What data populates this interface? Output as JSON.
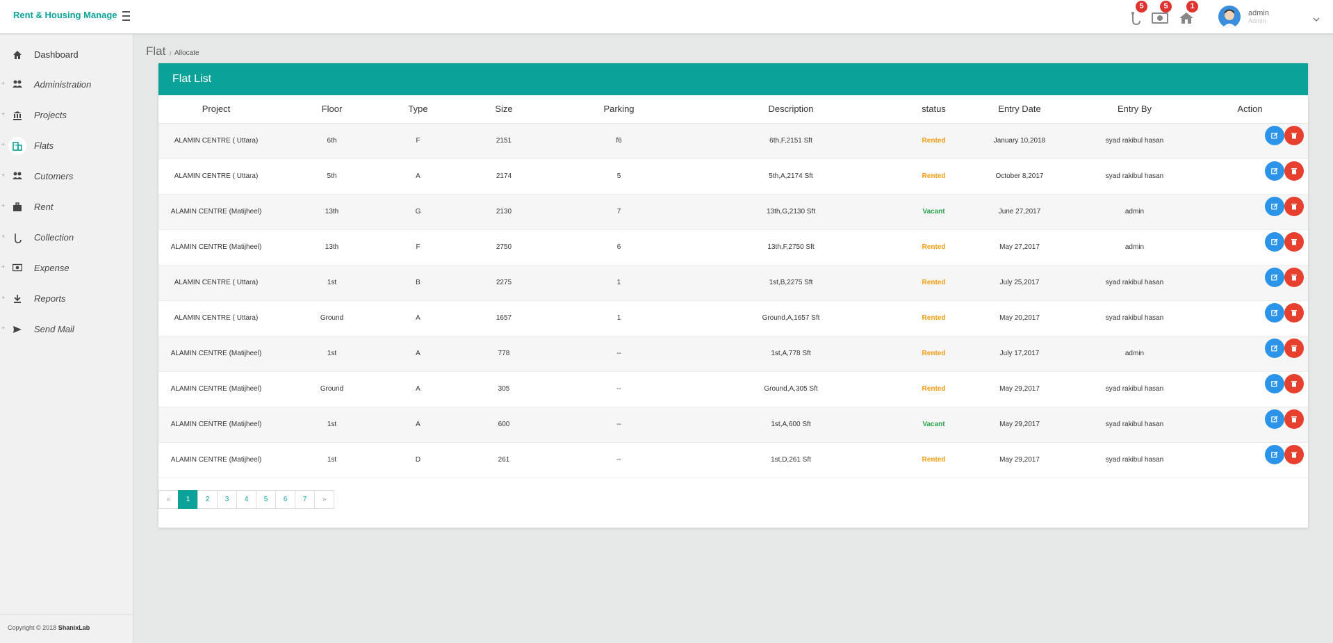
{
  "header": {
    "brand": "Rent & Housing Manage",
    "notifications": [
      {
        "icon": "collection-hook-icon",
        "count": "5"
      },
      {
        "icon": "money-icon",
        "count": "5"
      },
      {
        "icon": "home-icon",
        "count": "1"
      }
    ],
    "user": {
      "name": "admin",
      "role": "Admin"
    }
  },
  "sidebar": {
    "items": [
      {
        "label": "Dashboard",
        "icon": "home-icon"
      },
      {
        "label": "Administration",
        "icon": "people-icon"
      },
      {
        "label": "Projects",
        "icon": "bank-icon"
      },
      {
        "label": "Flats",
        "icon": "building-icon"
      },
      {
        "label": "Cutomers",
        "icon": "people-icon"
      },
      {
        "label": "Rent",
        "icon": "briefcase-icon"
      },
      {
        "label": "Collection",
        "icon": "hook-icon"
      },
      {
        "label": "Expense",
        "icon": "money-icon"
      },
      {
        "label": "Reports",
        "icon": "download-icon"
      },
      {
        "label": "Send Mail",
        "icon": "send-icon"
      }
    ],
    "active": "Flats",
    "footer_prefix": "Copyright © 2018",
    "footer_brand": "ShanixLab"
  },
  "breadcrumb": {
    "title": "Flat",
    "sub": "Allocate"
  },
  "panel": {
    "title": "Flat List",
    "columns": [
      "Project",
      "Floor",
      "Type",
      "Size",
      "Parking",
      "Description",
      "status",
      "Entry Date",
      "Entry By",
      "Action"
    ],
    "rows": [
      {
        "project": "ALAMIN CENTRE ( Uttara)",
        "floor": "6th",
        "type": "F",
        "size": "2151",
        "parking": "f6",
        "description": "6th,F,2151 Sft",
        "status": "Rented",
        "date": "January 10,2018",
        "by": "syad rakibul hasan"
      },
      {
        "project": "ALAMIN CENTRE ( Uttara)",
        "floor": "5th",
        "type": "A",
        "size": "2174",
        "parking": "5",
        "description": "5th,A,2174 Sft",
        "status": "Rented",
        "date": "October 8,2017",
        "by": "syad rakibul hasan"
      },
      {
        "project": "ALAMIN CENTRE (Matijheel)",
        "floor": "13th",
        "type": "G",
        "size": "2130",
        "parking": "7",
        "description": "13th,G,2130 Sft",
        "status": "Vacant",
        "date": "June 27,2017",
        "by": "admin"
      },
      {
        "project": "ALAMIN CENTRE (Matijheel)",
        "floor": "13th",
        "type": "F",
        "size": "2750",
        "parking": "6",
        "description": "13th,F,2750 Sft",
        "status": "Rented",
        "date": "May 27,2017",
        "by": "admin"
      },
      {
        "project": "ALAMIN CENTRE ( Uttara)",
        "floor": "1st",
        "type": "B",
        "size": "2275",
        "parking": "1",
        "description": "1st,B,2275 Sft",
        "status": "Rented",
        "date": "July 25,2017",
        "by": "syad rakibul hasan"
      },
      {
        "project": "ALAMIN CENTRE ( Uttara)",
        "floor": "Ground",
        "type": "A",
        "size": "1657",
        "parking": "1",
        "description": "Ground,A,1657 Sft",
        "status": "Rented",
        "date": "May 20,2017",
        "by": "syad rakibul hasan"
      },
      {
        "project": "ALAMIN CENTRE (Matijheel)",
        "floor": "1st",
        "type": "A",
        "size": "778",
        "parking": "--",
        "description": "1st,A,778 Sft",
        "status": "Rented",
        "date": "July 17,2017",
        "by": "admin"
      },
      {
        "project": "ALAMIN CENTRE (Matijheel)",
        "floor": "Ground",
        "type": "A",
        "size": "305",
        "parking": "--",
        "description": "Ground,A,305 Sft",
        "status": "Rented",
        "date": "May 29,2017",
        "by": "syad rakibul hasan"
      },
      {
        "project": "ALAMIN CENTRE (Matijheel)",
        "floor": "1st",
        "type": "A",
        "size": "600",
        "parking": "--",
        "description": "1st,A,600 Sft",
        "status": "Vacant",
        "date": "May 29,2017",
        "by": "syad rakibul hasan"
      },
      {
        "project": "ALAMIN CENTRE (Matijheel)",
        "floor": "1st",
        "type": "D",
        "size": "261",
        "parking": "--",
        "description": "1st,D,261 Sft",
        "status": "Rented",
        "date": "May 29,2017",
        "by": "syad rakibul hasan"
      }
    ]
  },
  "pagination": {
    "prev": "«",
    "pages": [
      "1",
      "2",
      "3",
      "4",
      "5",
      "6",
      "7"
    ],
    "current": "1",
    "next": "»"
  },
  "colors": {
    "brand": "#0ba29a",
    "rented": "#f39c12",
    "vacant": "#2aa34a",
    "edit": "#2b93e8",
    "delete": "#e8402e",
    "badge": "#e0322e"
  }
}
